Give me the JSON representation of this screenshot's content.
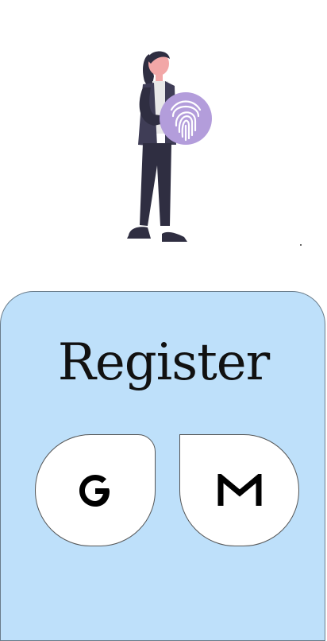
{
  "screen": {
    "title": "Register"
  },
  "buttons": {
    "google": {
      "icon": "google-g-icon"
    },
    "gmail": {
      "icon": "gmail-m-icon"
    }
  },
  "colors": {
    "card_background": "#bee0fa",
    "accent_purple": "#b39ddb",
    "figure_dark": "#2f2e41"
  }
}
